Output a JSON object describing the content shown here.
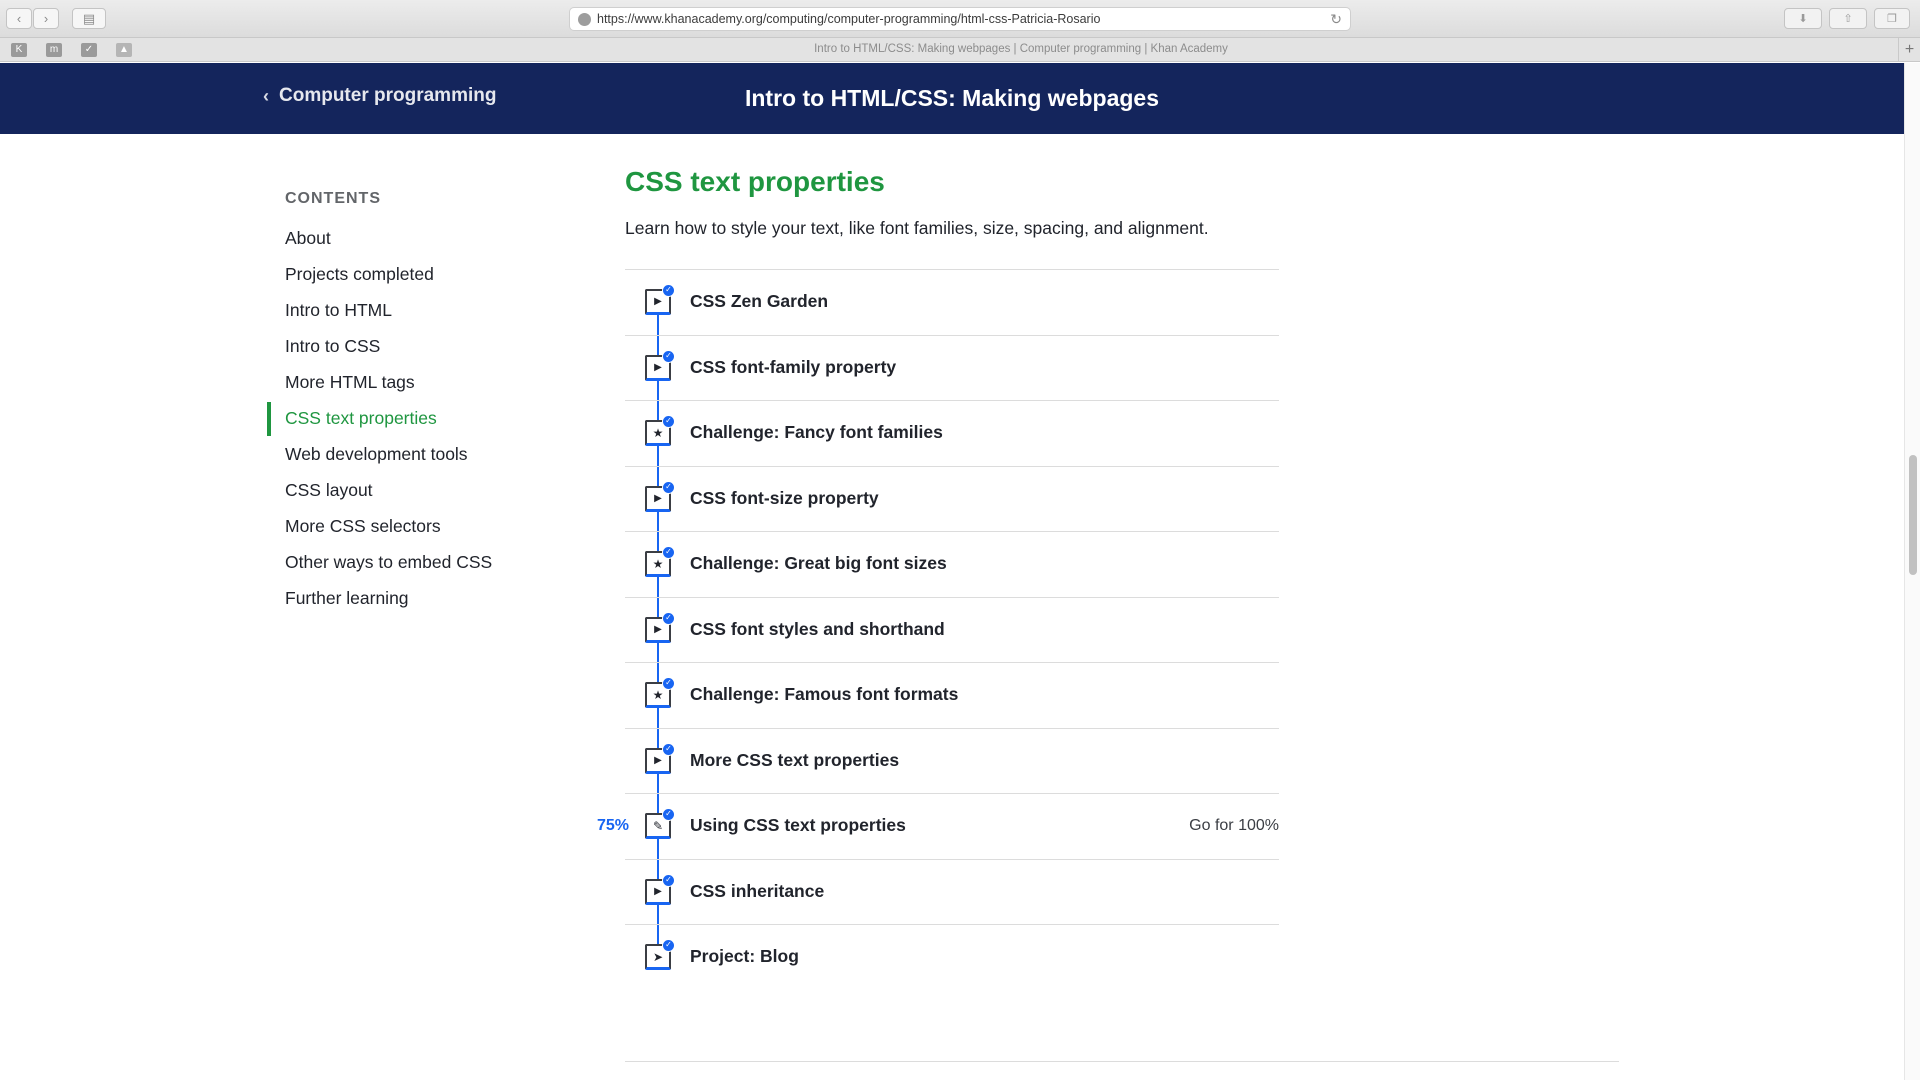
{
  "browser": {
    "url": "https://www.khanacademy.org/computing/computer-programming/html-css-Patricia-Rosario",
    "tab_title": "Intro to HTML/CSS: Making webpages | Computer programming | Khan Academy"
  },
  "header": {
    "back_label": "Computer programming",
    "title": "Intro to HTML/CSS: Making webpages"
  },
  "sidebar": {
    "heading": "CONTENTS",
    "items": [
      {
        "label": "About"
      },
      {
        "label": "Projects completed"
      },
      {
        "label": "Intro to HTML"
      },
      {
        "label": "Intro to CSS"
      },
      {
        "label": "More HTML tags"
      },
      {
        "label": "CSS text properties",
        "active": true
      },
      {
        "label": "Web development tools"
      },
      {
        "label": "CSS layout"
      },
      {
        "label": "More CSS selectors"
      },
      {
        "label": "Other ways to embed CSS"
      },
      {
        "label": "Further learning"
      }
    ]
  },
  "section": {
    "title": "CSS text properties",
    "description": "Learn how to style your text, like font families, size, spacing, and alignment.",
    "lessons": [
      {
        "label": "CSS Zen Garden",
        "icon": "play-icon"
      },
      {
        "label": "CSS font-family property",
        "icon": "play-icon"
      },
      {
        "label": "Challenge: Fancy font families",
        "icon": "star-icon"
      },
      {
        "label": "CSS font-size property",
        "icon": "play-icon"
      },
      {
        "label": "Challenge: Great big font sizes",
        "icon": "star-icon"
      },
      {
        "label": "CSS font styles and shorthand",
        "icon": "play-icon"
      },
      {
        "label": "Challenge: Famous font formats",
        "icon": "star-icon"
      },
      {
        "label": "More CSS text properties",
        "icon": "play-icon"
      },
      {
        "label": "Using CSS text properties",
        "icon": "pencil-icon",
        "percent": "75%",
        "action": "Go for 100%"
      },
      {
        "label": "CSS inheritance",
        "icon": "play-icon"
      },
      {
        "label": "Project: Blog",
        "icon": "rocket-icon"
      }
    ]
  },
  "colors": {
    "header_bg": "#14255c",
    "accent_green": "#1f9640",
    "accent_blue": "#1865f2"
  }
}
